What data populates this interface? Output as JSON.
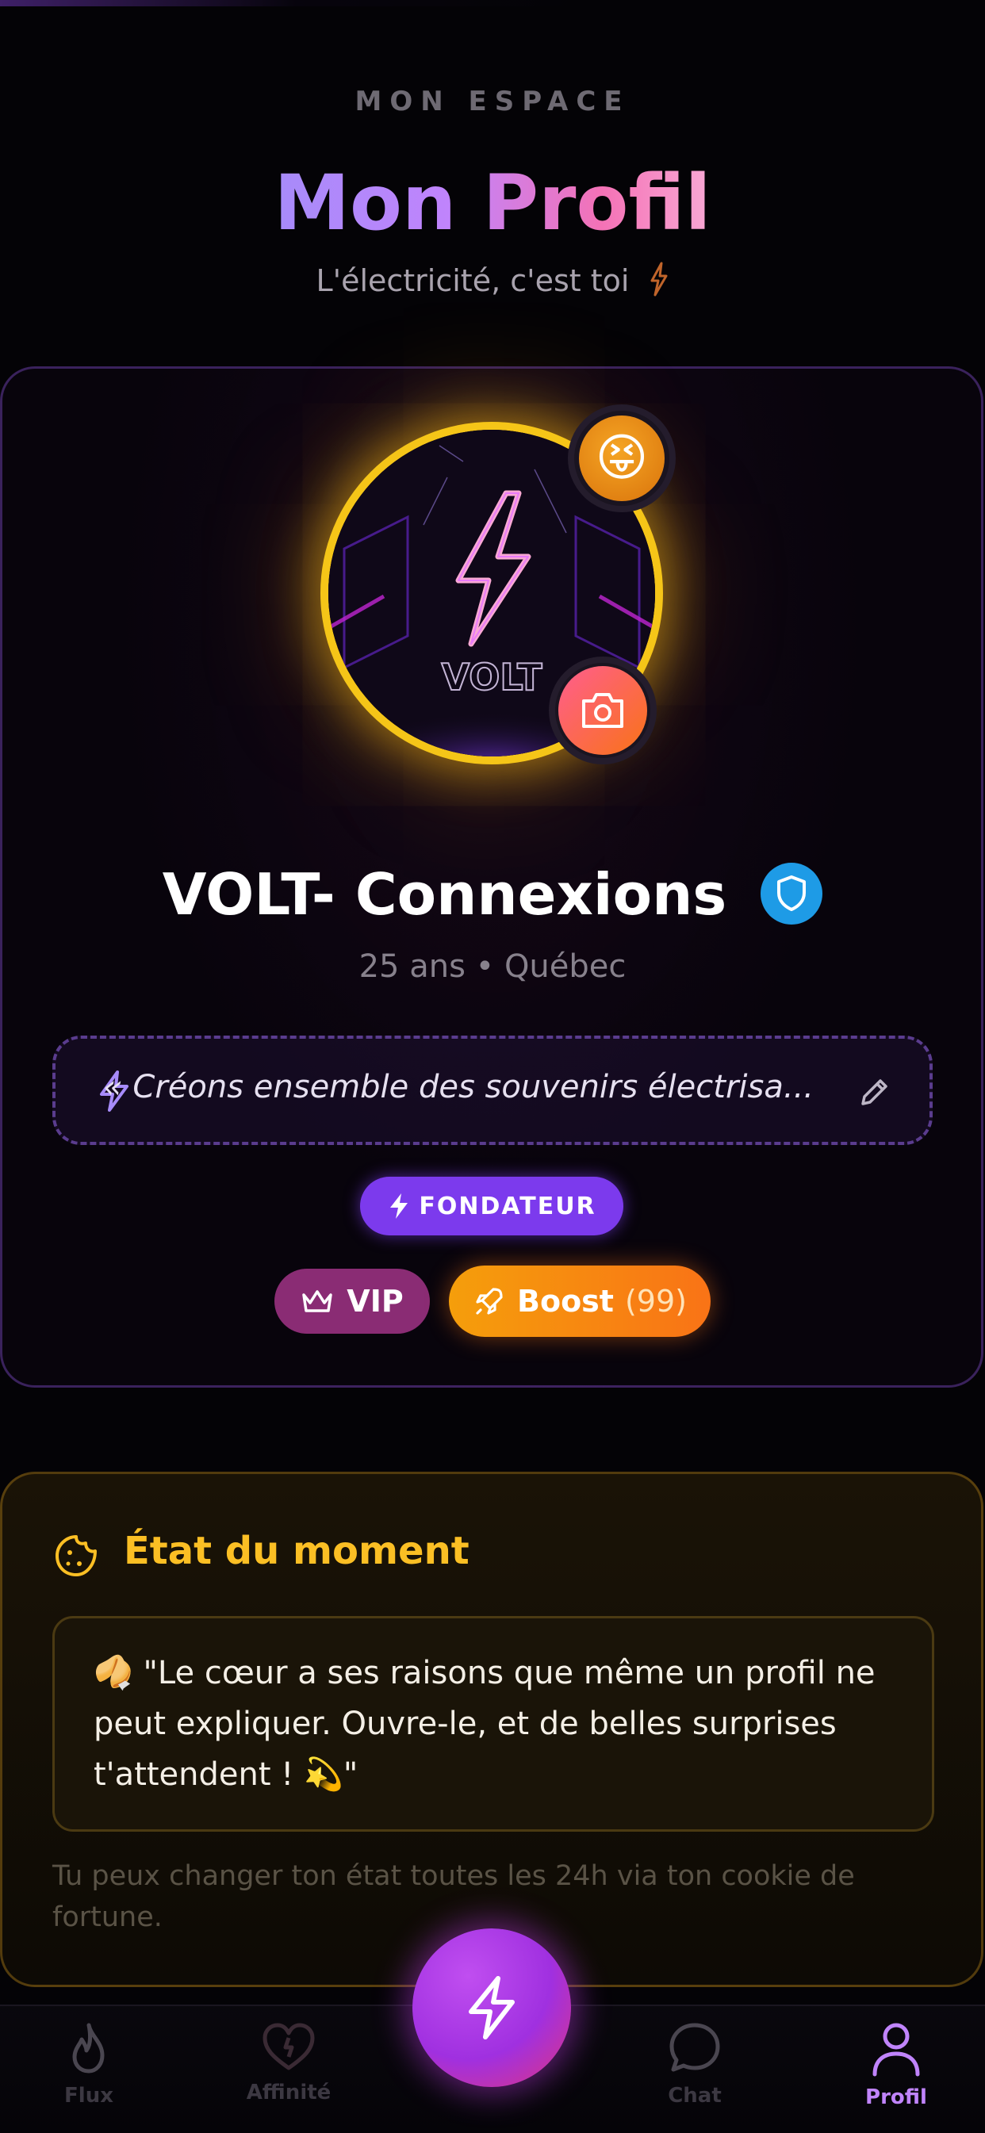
{
  "header": {
    "eyebrow": "MON ESPACE",
    "title": "Mon Profil",
    "subtitle": "L'électricité, c'est toi"
  },
  "profile": {
    "avatar_text": "VOLT",
    "mood_emoji": "😝",
    "name": "VOLT- Connexions",
    "meta": "25 ans • Québec",
    "bio": "« Créons ensemble des souvenirs électrisa...",
    "founder_badge": "FONDATEUR",
    "vip_label": "VIP",
    "boost_label": "Boost",
    "boost_count": "(99)"
  },
  "mood": {
    "title": "État du moment",
    "quote": "🥠 \"Le cœur a ses raisons que même un profil ne peut expliquer. Ouvre-le, et de belles surprises t'attendent ! 💫\"",
    "hint": "Tu peux changer ton état toutes les 24h via ton cookie de fortune."
  },
  "nav": {
    "items": [
      {
        "label": "Flux",
        "icon": "flame-icon"
      },
      {
        "label": "Affinité",
        "icon": "heart-icon"
      },
      {
        "label": "Chat",
        "icon": "chat-icon"
      },
      {
        "label": "Profil",
        "icon": "user-icon"
      }
    ],
    "active": "Profil",
    "fab_icon": "bolt-icon"
  },
  "colors": {
    "accent_purple": "#a78bfa",
    "accent_pink": "#f472b6",
    "gold": "#fbbf24",
    "boost_orange": "#f97316",
    "verified_blue": "#1e9be6"
  }
}
